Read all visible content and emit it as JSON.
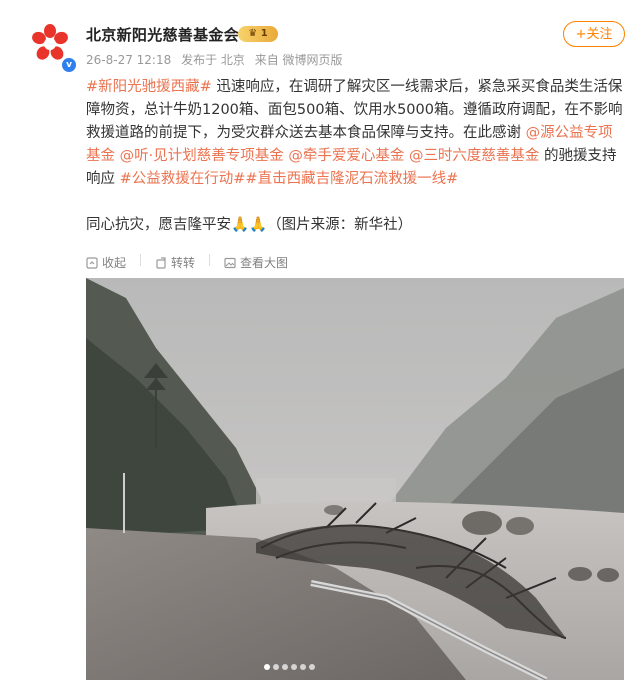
{
  "post": {
    "author": "北京新阳光慈善基金会",
    "vip_badge": "1",
    "date": "26-8-27 12:18",
    "posted_from": "发布于 北京",
    "source": "来自 微博网页版",
    "follow_label": "+关注",
    "text": {
      "tag1": "#新阳光驰援西藏#",
      "t1": " 迅速响应，在调研了解灾区一线需求后，紧急采买食品类生活保障物资，总计牛奶1200箱、面包500箱、饮用水5000箱。遵循政府调配，在不影响救援道路的前提下，为受灾群众送去基本食品保障与支持。在此感谢",
      "m1": "@源公益专项基金",
      "m2": "@听·见计划慈善专项基金",
      "m3": "@牵手爱爱心基金",
      "m4": "@三时六度慈善基金",
      "t2": " 的驰援支持响应 ",
      "tag2": "#公益救援在行动#",
      "tag3": "#直击西藏吉隆泥石流救援一线#",
      "line2": "同心抗灾，愿吉隆平安🙏🙏（图片来源：新华社）"
    },
    "actions": {
      "collapse": "收起",
      "rotate": "转转",
      "view_large": "查看大图"
    },
    "icons": {
      "avatar": "sunflower-logo-icon",
      "collapse": "collapse-icon",
      "rotate": "rotate-icon",
      "view": "image-icon"
    },
    "image_page_indicator": {
      "count": 6,
      "current": 1
    },
    "colors": {
      "accent": "#ff8200",
      "link": "#eb7350",
      "meta": "#999999"
    }
  }
}
